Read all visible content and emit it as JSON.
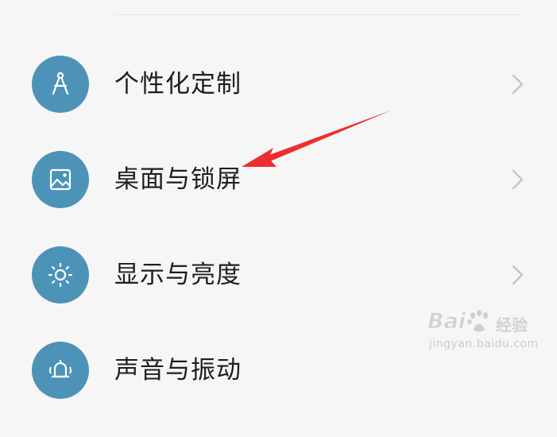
{
  "settings": {
    "items": [
      {
        "label": "个性化定制",
        "icon": "compass-icon"
      },
      {
        "label": "桌面与锁屏",
        "icon": "image-icon"
      },
      {
        "label": "显示与亮度",
        "icon": "sun-icon"
      },
      {
        "label": "声音与振动",
        "icon": "bell-icon"
      }
    ],
    "chevron_icon": "chevron-right-icon",
    "icon_color": "#4d93b8",
    "chevron_color": "#c4c4c4"
  },
  "annotation": {
    "arrow_color": "#ee2e2e",
    "points_to": "桌面与锁屏"
  },
  "watermark": {
    "brand": "Bai",
    "brand_suffix": "经验",
    "url": "jingyan.baidu.com"
  }
}
